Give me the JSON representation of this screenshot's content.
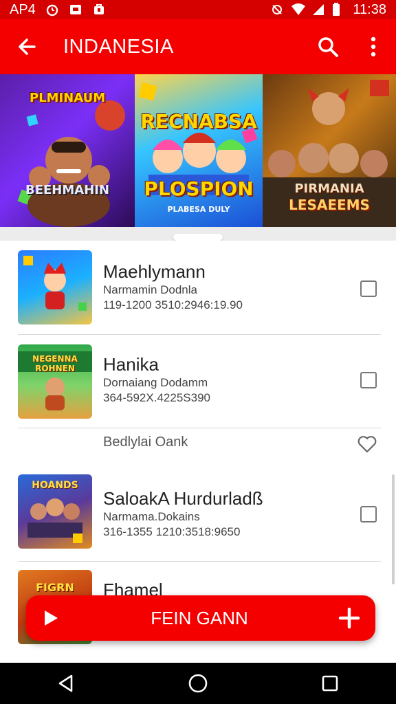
{
  "status_bar": {
    "carrier": "AP4",
    "time": "11:38"
  },
  "app_bar": {
    "title": "INDANESIA"
  },
  "banner": [
    {
      "top_text": "PLMINAUM",
      "bottom_text": "BEEHMAHIN"
    },
    {
      "top_text": "RECNABSA",
      "bottom_text": "PLOSPION",
      "tag": "PLABESA DULY"
    },
    {
      "top_text": "PIRMANIA",
      "bottom_text": "LESAEEMS"
    }
  ],
  "list": {
    "items": [
      {
        "title": "Maehlymann",
        "subtitle": "Narmamin Dodnla",
        "meta": "119-1200 3510:2946:19.90",
        "thumb_label": ""
      },
      {
        "title": "Hanika",
        "subtitle": "Dornaiang Dodamm",
        "meta": "364-592X.4225S390",
        "thumb_label": "NEGENNA ROHNEN"
      },
      {
        "title": "SaloakA Hurdurladß",
        "subtitle": "Narmama.Dokains",
        "meta": "316-1355 1210:3518:9650",
        "thumb_label": "HOANDS"
      },
      {
        "title": "Fhamel",
        "subtitle": "",
        "meta": "",
        "thumb_label": "FIGRN"
      }
    ],
    "subheader": "Bedlylai  Oank"
  },
  "fab": {
    "label": "FEIN GANN"
  },
  "colors": {
    "primary": "#f40000",
    "status": "#d50000"
  }
}
